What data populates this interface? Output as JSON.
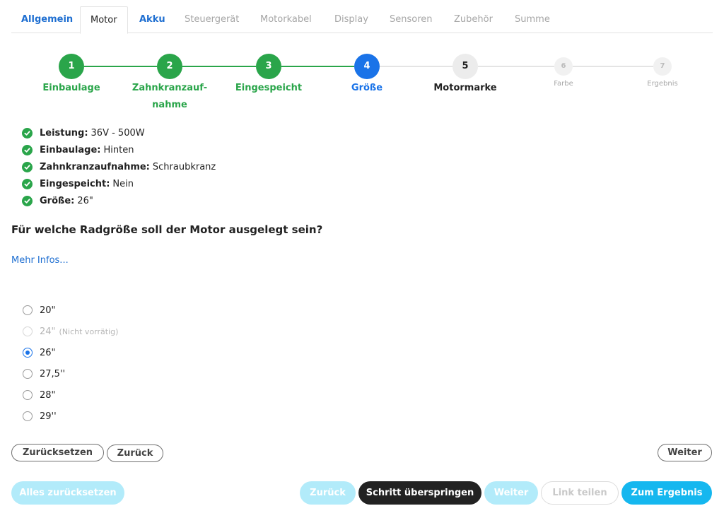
{
  "tabs": [
    {
      "label": "Allgemein",
      "state": "link"
    },
    {
      "label": "Motor",
      "state": "active"
    },
    {
      "label": "Akku",
      "state": "link"
    },
    {
      "label": "Steuergerät",
      "state": "dim"
    },
    {
      "label": "Motorkabel",
      "state": "dim"
    },
    {
      "label": "Display",
      "state": "dim"
    },
    {
      "label": "Sensoren",
      "state": "dim"
    },
    {
      "label": "Zubehör",
      "state": "dim"
    },
    {
      "label": "Summe",
      "state": "dim"
    }
  ],
  "steps": [
    {
      "number": "1",
      "label": "Einbaulage",
      "state": "done"
    },
    {
      "number": "2",
      "label": "Zahnkranzauf-nahme",
      "label_line1": "Zahnkranzauf-",
      "label_line2": "nahme",
      "state": "done"
    },
    {
      "number": "3",
      "label": "Eingespeicht",
      "state": "done"
    },
    {
      "number": "4",
      "label": "Größe",
      "state": "current"
    },
    {
      "number": "5",
      "label": "Motormarke",
      "state": "next"
    },
    {
      "number": "6",
      "label": "Farbe",
      "state": "later"
    },
    {
      "number": "7",
      "label": "Ergebnis",
      "state": "later"
    }
  ],
  "summary": [
    {
      "key": "Leistung:",
      "value": "36V - 500W"
    },
    {
      "key": "Einbaulage:",
      "value": "Hinten"
    },
    {
      "key": "Zahnkranzaufnahme:",
      "value": "Schraubkranz"
    },
    {
      "key": "Eingespeicht:",
      "value": "Nein"
    },
    {
      "key": "Größe:",
      "value": "26\""
    }
  ],
  "question": "Für welche Radgröße soll der Motor ausgelegt sein?",
  "more_info": "Mehr Infos...",
  "options": [
    {
      "label": "20\"",
      "note": "",
      "checked": false,
      "disabled": false
    },
    {
      "label": "24\"",
      "note": "(Nicht vorrätig)",
      "checked": false,
      "disabled": true
    },
    {
      "label": "26\"",
      "note": "",
      "checked": true,
      "disabled": false
    },
    {
      "label": "27,5''",
      "note": "",
      "checked": false,
      "disabled": false
    },
    {
      "label": "28\"",
      "note": "",
      "checked": false,
      "disabled": false
    },
    {
      "label": "29''",
      "note": "",
      "checked": false,
      "disabled": false
    }
  ],
  "step_buttons": {
    "reset": "Zurücksetzen",
    "back": "Zurück",
    "next": "Weiter"
  },
  "footer_buttons": {
    "reset_all": "Alles zurücksetzen",
    "back": "Zurück",
    "skip": "Schritt überspringen",
    "next": "Weiter",
    "share": "Link teilen",
    "result": "Zum Ergebnis"
  },
  "colors": {
    "done": "#2aa54a",
    "current": "#1a73e8",
    "link": "#1f6fd1",
    "primary_button": "#15b7ef",
    "dark_button": "#222222"
  }
}
